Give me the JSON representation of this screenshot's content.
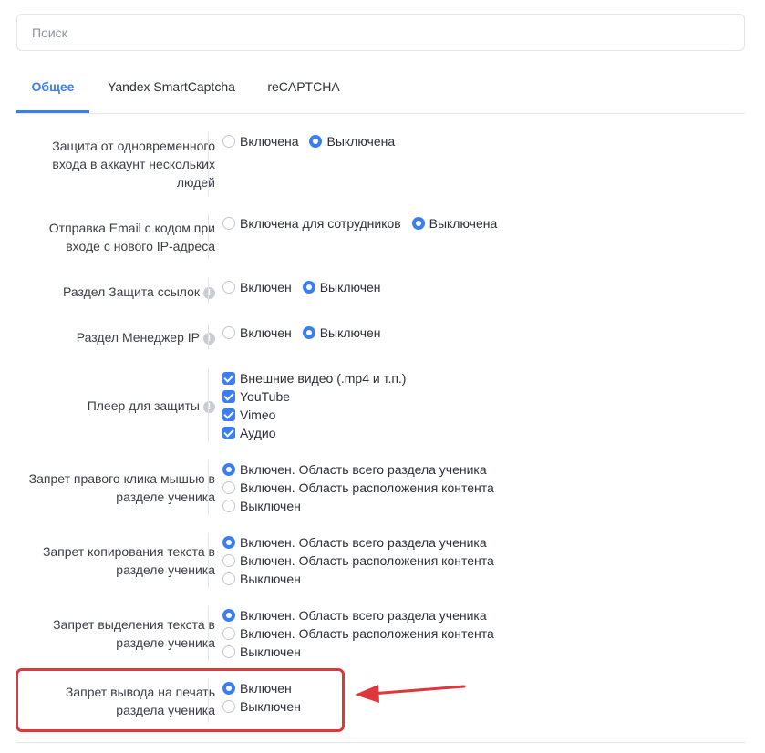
{
  "search": {
    "placeholder": "Поиск",
    "value": ""
  },
  "tabs": [
    {
      "label": "Общее",
      "active": true
    },
    {
      "label": "Yandex SmartCaptcha",
      "active": false
    },
    {
      "label": "reCAPTCHA",
      "active": false
    }
  ],
  "settings": {
    "multi_login": {
      "label": "Защита от одновременного входа в аккаунт нескольких людей",
      "options": [
        {
          "label": "Включена",
          "selected": false
        },
        {
          "label": "Выключена",
          "selected": true
        }
      ]
    },
    "email_new_ip": {
      "label": "Отправка Email с кодом при входе с нового IP-адреса",
      "options": [
        {
          "label": "Включена для сотрудников",
          "selected": false
        },
        {
          "label": "Выключена",
          "selected": true
        }
      ]
    },
    "link_protection": {
      "label": "Раздел Защита ссылок",
      "options": [
        {
          "label": "Включен",
          "selected": false
        },
        {
          "label": "Выключен",
          "selected": true
        }
      ]
    },
    "ip_manager": {
      "label": "Раздел Менеджер IP",
      "options": [
        {
          "label": "Включен",
          "selected": false
        },
        {
          "label": "Выключен",
          "selected": true
        }
      ]
    },
    "protected_player": {
      "label": "Плеер для защиты",
      "options": [
        {
          "label": "Внешние видео (.mp4 и т.п.)",
          "checked": true
        },
        {
          "label": "YouTube",
          "checked": true
        },
        {
          "label": "Vimeo",
          "checked": true
        },
        {
          "label": "Аудио",
          "checked": true
        }
      ]
    },
    "right_click_ban": {
      "label": "Запрет правого клика мышью в разделе ученика",
      "options": [
        {
          "label": "Включен. Область всего раздела ученика",
          "selected": true
        },
        {
          "label": "Включен. Область расположения контента",
          "selected": false
        },
        {
          "label": "Выключен",
          "selected": false
        }
      ]
    },
    "copy_ban": {
      "label": "Запрет копирования текста в разделе ученика",
      "options": [
        {
          "label": "Включен. Область всего раздела ученика",
          "selected": true
        },
        {
          "label": "Включен. Область расположения контента",
          "selected": false
        },
        {
          "label": "Выключен",
          "selected": false
        }
      ]
    },
    "select_ban": {
      "label": "Запрет выделения текста в разделе ученика",
      "options": [
        {
          "label": "Включен. Область всего раздела ученика",
          "selected": true
        },
        {
          "label": "Включен. Область расположения контента",
          "selected": false
        },
        {
          "label": "Выключен",
          "selected": false
        }
      ]
    },
    "print_ban": {
      "label": "Запрет вывода на печать раздела ученика",
      "options": [
        {
          "label": "Включен",
          "selected": true
        },
        {
          "label": "Выключен",
          "selected": false
        }
      ]
    }
  },
  "colors": {
    "accent": "#3a7ff0",
    "annotation": "#e0373a"
  },
  "annotation": {
    "icon": "arrow-left-icon"
  }
}
